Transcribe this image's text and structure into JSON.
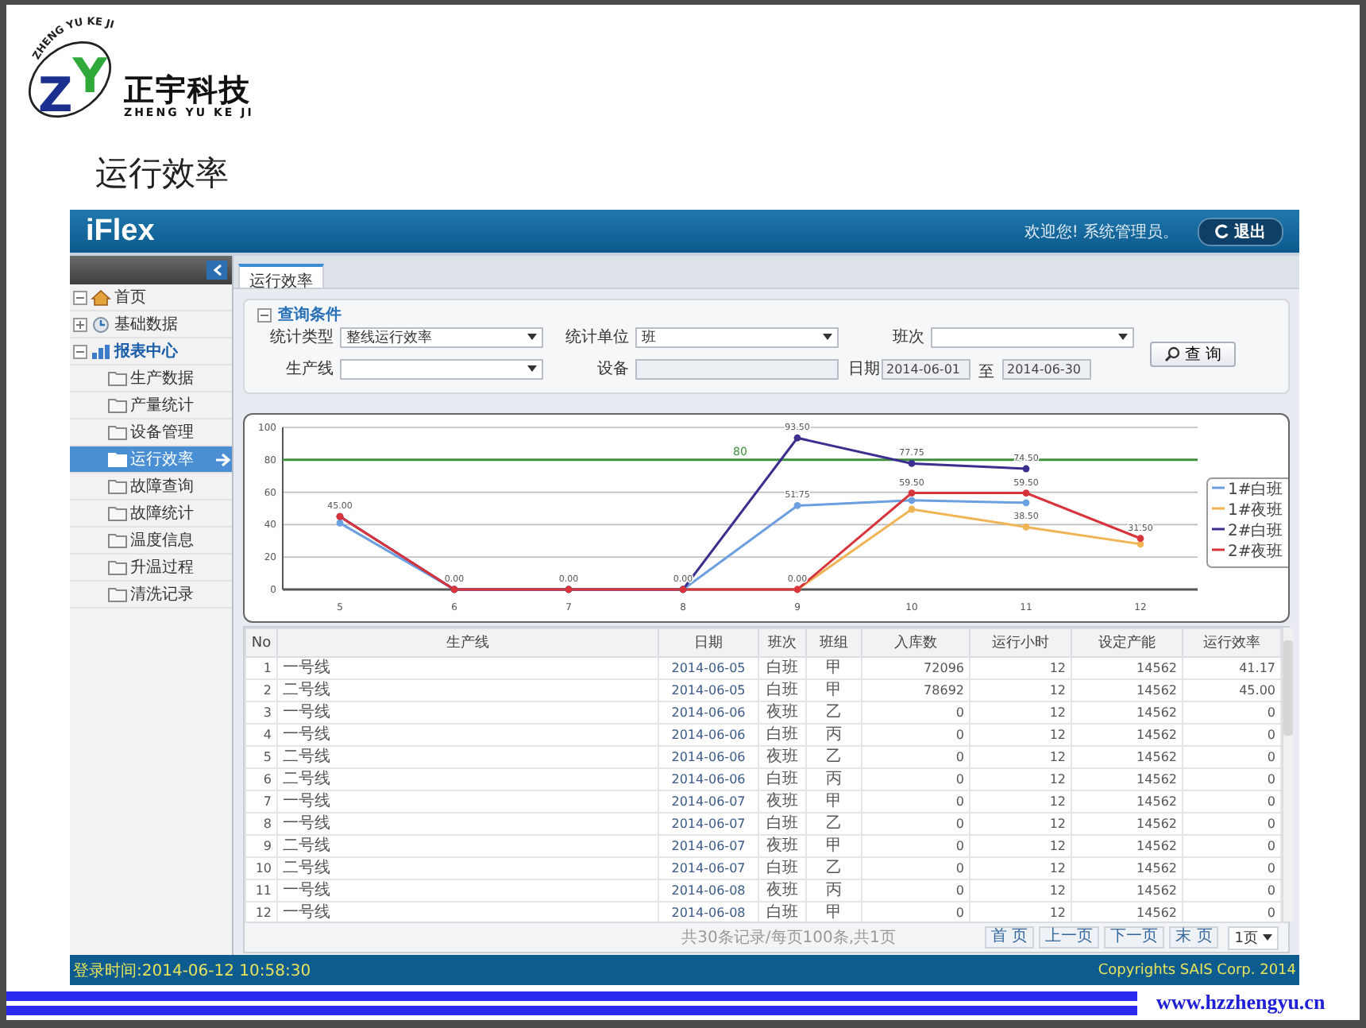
{
  "slide": {
    "logo": {
      "arc_text": "ZHENG YU KE JI",
      "letters": "ZY",
      "name": "正宇科技",
      "pinyin": "ZHENG YU KE JI"
    },
    "title": "运行效率",
    "website": "www.hzzhengyu.cn"
  },
  "header": {
    "title": "iFlex",
    "welcome": "欢迎您! 系统管理员。",
    "logout": "退出"
  },
  "sidebar": {
    "items": [
      {
        "label": "首页",
        "kind": "home",
        "expanded": true
      },
      {
        "label": "基础数据",
        "kind": "clock",
        "expanded": false
      },
      {
        "label": "报表中心",
        "kind": "chart",
        "expanded": true,
        "children": [
          {
            "label": "生产数据",
            "selected": false
          },
          {
            "label": "产量统计",
            "selected": false
          },
          {
            "label": "设备管理",
            "selected": false
          },
          {
            "label": "运行效率",
            "selected": true
          },
          {
            "label": "故障查询",
            "selected": false
          },
          {
            "label": "故障统计",
            "selected": false
          },
          {
            "label": "温度信息",
            "selected": false
          },
          {
            "label": "升温过程",
            "selected": false
          },
          {
            "label": "清洗记录",
            "selected": false
          }
        ]
      }
    ]
  },
  "tabs": [
    {
      "label": "运行效率",
      "selected": true
    }
  ],
  "query": {
    "title": "查询条件",
    "expanded": true,
    "fields": [
      {
        "label": "统计类型",
        "kind": "select",
        "value": "整线运行效率",
        "disabled": false
      },
      {
        "label": "统计单位",
        "kind": "select",
        "value": "班",
        "disabled": false
      },
      {
        "label": "班次",
        "kind": "select",
        "disabled": false
      },
      {
        "label": "生产线",
        "kind": "select",
        "disabled": false
      },
      {
        "label": "设备",
        "kind": "select",
        "disabled": true
      },
      {
        "label": "日期",
        "kind": "daterange",
        "from": "2014-06-01",
        "separator": "至",
        "to": "2014-06-30",
        "disabled": false
      }
    ],
    "button": "查 询"
  },
  "chart": {
    "chart_data": {
      "type": "line",
      "categories": [
        "5",
        "6",
        "7",
        "8",
        "9",
        "10",
        "11",
        "12"
      ],
      "ylim": [
        0,
        100
      ],
      "yticks": [
        0,
        20,
        40,
        60,
        80,
        100
      ],
      "series": [
        {
          "name": "1#白班",
          "color": "#6b9fe0",
          "marker": "circle",
          "values": [
            41,
            0,
            0,
            0,
            51.75,
            55,
            53.5,
            null
          ],
          "value_labels": [
            null,
            "0.00",
            "0.00",
            "0.00",
            "51.75",
            null,
            null,
            null
          ]
        },
        {
          "name": "1#夜班",
          "color": "#f0b455",
          "marker": "circle",
          "values": [
            null,
            null,
            null,
            null,
            0,
            49.5,
            38.5,
            28
          ],
          "value_labels": [
            null,
            null,
            null,
            null,
            null,
            null,
            "38.50",
            null
          ]
        },
        {
          "name": "2#白班",
          "color": "#3b2f8f",
          "marker": "circle",
          "values": [
            45,
            0,
            0,
            0,
            93.5,
            77.75,
            74.5,
            null
          ],
          "value_labels": [
            "45.00",
            null,
            null,
            null,
            "93.50",
            "77.75",
            "74.50",
            null
          ]
        },
        {
          "name": "2#夜班",
          "color": "#d8343b",
          "marker": "circle",
          "values": [
            45,
            0,
            0,
            0,
            0,
            59.5,
            59.5,
            31.5
          ],
          "value_labels": [
            null,
            null,
            null,
            null,
            "0.00",
            "59.50",
            "59.50",
            "31.50"
          ]
        }
      ],
      "ref_lines": [
        {
          "axis": "y",
          "value": 80,
          "label": "80",
          "color": "#3f8f3f"
        }
      ],
      "grid": true,
      "legend": "right"
    }
  },
  "table": {
    "columns": [
      "No",
      "生产线",
      "日期",
      "班次",
      "班组",
      "入库数",
      "运行小时",
      "设定产能",
      "运行效率"
    ],
    "rows": [
      [
        "1",
        "一号线",
        "2014-06-05",
        "白班",
        "甲",
        "72096",
        "12",
        "14562",
        "41.17"
      ],
      [
        "2",
        "二号线",
        "2014-06-05",
        "白班",
        "甲",
        "78692",
        "12",
        "14562",
        "45.00"
      ],
      [
        "3",
        "一号线",
        "2014-06-06",
        "夜班",
        "乙",
        "0",
        "12",
        "14562",
        "0"
      ],
      [
        "4",
        "一号线",
        "2014-06-06",
        "白班",
        "丙",
        "0",
        "12",
        "14562",
        "0"
      ],
      [
        "5",
        "二号线",
        "2014-06-06",
        "夜班",
        "乙",
        "0",
        "12",
        "14562",
        "0"
      ],
      [
        "6",
        "二号线",
        "2014-06-06",
        "白班",
        "丙",
        "0",
        "12",
        "14562",
        "0"
      ],
      [
        "7",
        "一号线",
        "2014-06-07",
        "夜班",
        "甲",
        "0",
        "12",
        "14562",
        "0"
      ],
      [
        "8",
        "一号线",
        "2014-06-07",
        "白班",
        "乙",
        "0",
        "12",
        "14562",
        "0"
      ],
      [
        "9",
        "二号线",
        "2014-06-07",
        "夜班",
        "甲",
        "0",
        "12",
        "14562",
        "0"
      ],
      [
        "10",
        "二号线",
        "2014-06-07",
        "白班",
        "乙",
        "0",
        "12",
        "14562",
        "0"
      ],
      [
        "11",
        "一号线",
        "2014-06-08",
        "夜班",
        "丙",
        "0",
        "12",
        "14562",
        "0"
      ],
      [
        "12",
        "一号线",
        "2014-06-08",
        "白班",
        "甲",
        "0",
        "12",
        "14562",
        "0"
      ]
    ],
    "pager": {
      "summary": "共30条记录/每页100条,共1页",
      "buttons": [
        "首 页",
        "上一页",
        "下一页",
        "末 页"
      ],
      "page_select": "1页"
    }
  },
  "footer": {
    "login_time": "登录时间:2014-06-12 10:58:30",
    "copyright": "Copyrights SAIS Corp. 2014"
  }
}
